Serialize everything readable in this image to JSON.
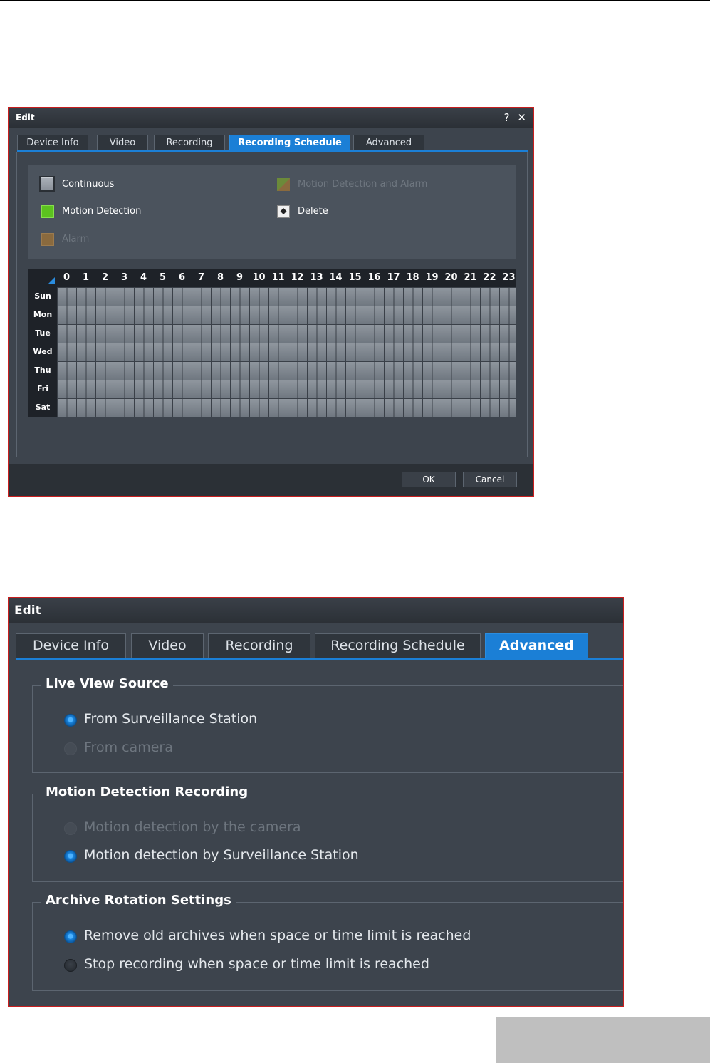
{
  "dialog1": {
    "title": "Edit",
    "help": "?",
    "close": "✕",
    "tabs": [
      "Device Info",
      "Video",
      "Recording",
      "Recording Schedule",
      "Advanced"
    ],
    "active_tab": "Recording Schedule",
    "legend": {
      "continuous": "Continuous",
      "motion_alarm": "Motion Detection and Alarm",
      "motion": "Motion Detection",
      "delete": "Delete",
      "alarm": "Alarm"
    },
    "hours": [
      "0",
      "1",
      "2",
      "3",
      "4",
      "5",
      "6",
      "7",
      "8",
      "9",
      "10",
      "11",
      "12",
      "13",
      "14",
      "15",
      "16",
      "17",
      "18",
      "19",
      "20",
      "21",
      "22",
      "23"
    ],
    "days": [
      "Sun",
      "Mon",
      "Tue",
      "Wed",
      "Thu",
      "Fri",
      "Sat"
    ],
    "buttons": {
      "ok": "OK",
      "cancel": "Cancel"
    }
  },
  "dialog2": {
    "title": "Edit",
    "tabs": [
      "Device Info",
      "Video",
      "Recording",
      "Recording Schedule",
      "Advanced"
    ],
    "active_tab": "Advanced",
    "live_view": {
      "title": "Live View Source",
      "options": [
        "From Surveillance Station",
        "From camera"
      ],
      "selected": "From Surveillance Station"
    },
    "motion": {
      "title": "Motion Detection Recording",
      "options": [
        "Motion detection by the camera",
        "Motion detection by Surveillance Station"
      ],
      "selected": "Motion detection by Surveillance Station"
    },
    "archive": {
      "title": "Archive Rotation Settings",
      "options": [
        "Remove old archives when space or time limit is reached",
        "Stop recording when space or time limit is reached"
      ],
      "selected": "Remove old archives when space or time limit is reached"
    }
  },
  "colors": {
    "accent": "#1b7fd6",
    "dialog_bg": "#3d444d",
    "motion_green": "#5cc21f",
    "alarm_brown": "#8a6a3e",
    "frame_red": "#c81e1e"
  }
}
